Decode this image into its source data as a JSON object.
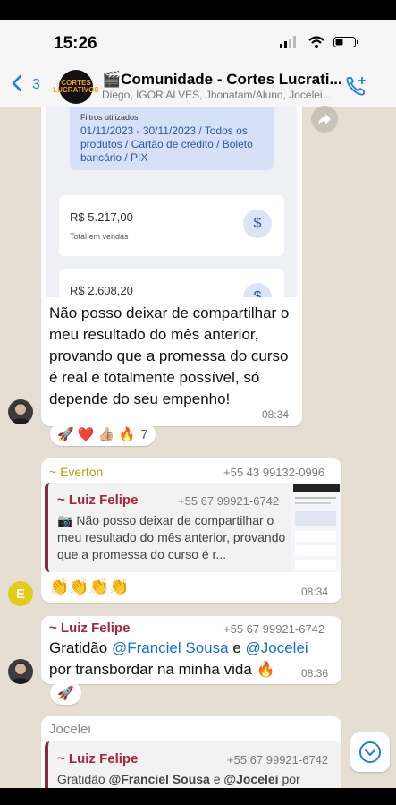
{
  "status": {
    "time": "15:26"
  },
  "header": {
    "back_count": "3",
    "group_logo_text": "CORTES\nLUCRATIVOS",
    "title": "🎬Comunidade - Cortes Lucrati...",
    "members": "Diego, IGOR ALVES, Jhonatam/Aluno, Jocelei..."
  },
  "msg1": {
    "image": {
      "filters_label": "Filtros utilizados",
      "filters_value": "01/11/2023 - 30/11/2023 / Todos os produtos / Cartão de crédito / Boleto bancário / PIX",
      "card1_value": "R$ 5.217,00",
      "card1_label": "Total em vendas",
      "card2_value": "R$ 2.608,20"
    },
    "text": "Não posso deixar de compartilhar o meu resultado do mês anterior, provando que a promessa do curso é real e totalmente possível, só depende do seu empenho!",
    "time": "08:34",
    "reactions": "🚀 ❤️ 👍🏼 🔥",
    "reaction_count": "7"
  },
  "msg2": {
    "sender": "~ Everton",
    "phone": "+55 43 99132-0996",
    "avatar_letter": "E",
    "quote": {
      "sender": "~ Luiz Felipe",
      "phone": "+55 67 99921-6742",
      "text": "Não posso deixar de compartilhar o meu resultado do mês anterior, provando que a promessa do curso é r..."
    },
    "text": "👏👏👏👏",
    "time": "08:34"
  },
  "msg3": {
    "sender": "~ Luiz Felipe",
    "phone": "+55 67 99921-6742",
    "text_a": "Gratidão ",
    "mention1": "@Franciel Sousa",
    "text_b": " e ",
    "mention2": "@Jocelei",
    "text_c": "por transbordar na minha vida 🔥",
    "time": "08:36",
    "reactions": "🚀"
  },
  "msg4": {
    "sender": "Jocelei",
    "quote": {
      "sender": "~ Luiz Felipe",
      "phone": "+55 67 99921-6742",
      "text_a": "Gratidão ",
      "bold1": "@Franciel Sousa",
      "text_b": " e ",
      "bold2": "@Jocelei",
      "text_c": " por"
    }
  }
}
